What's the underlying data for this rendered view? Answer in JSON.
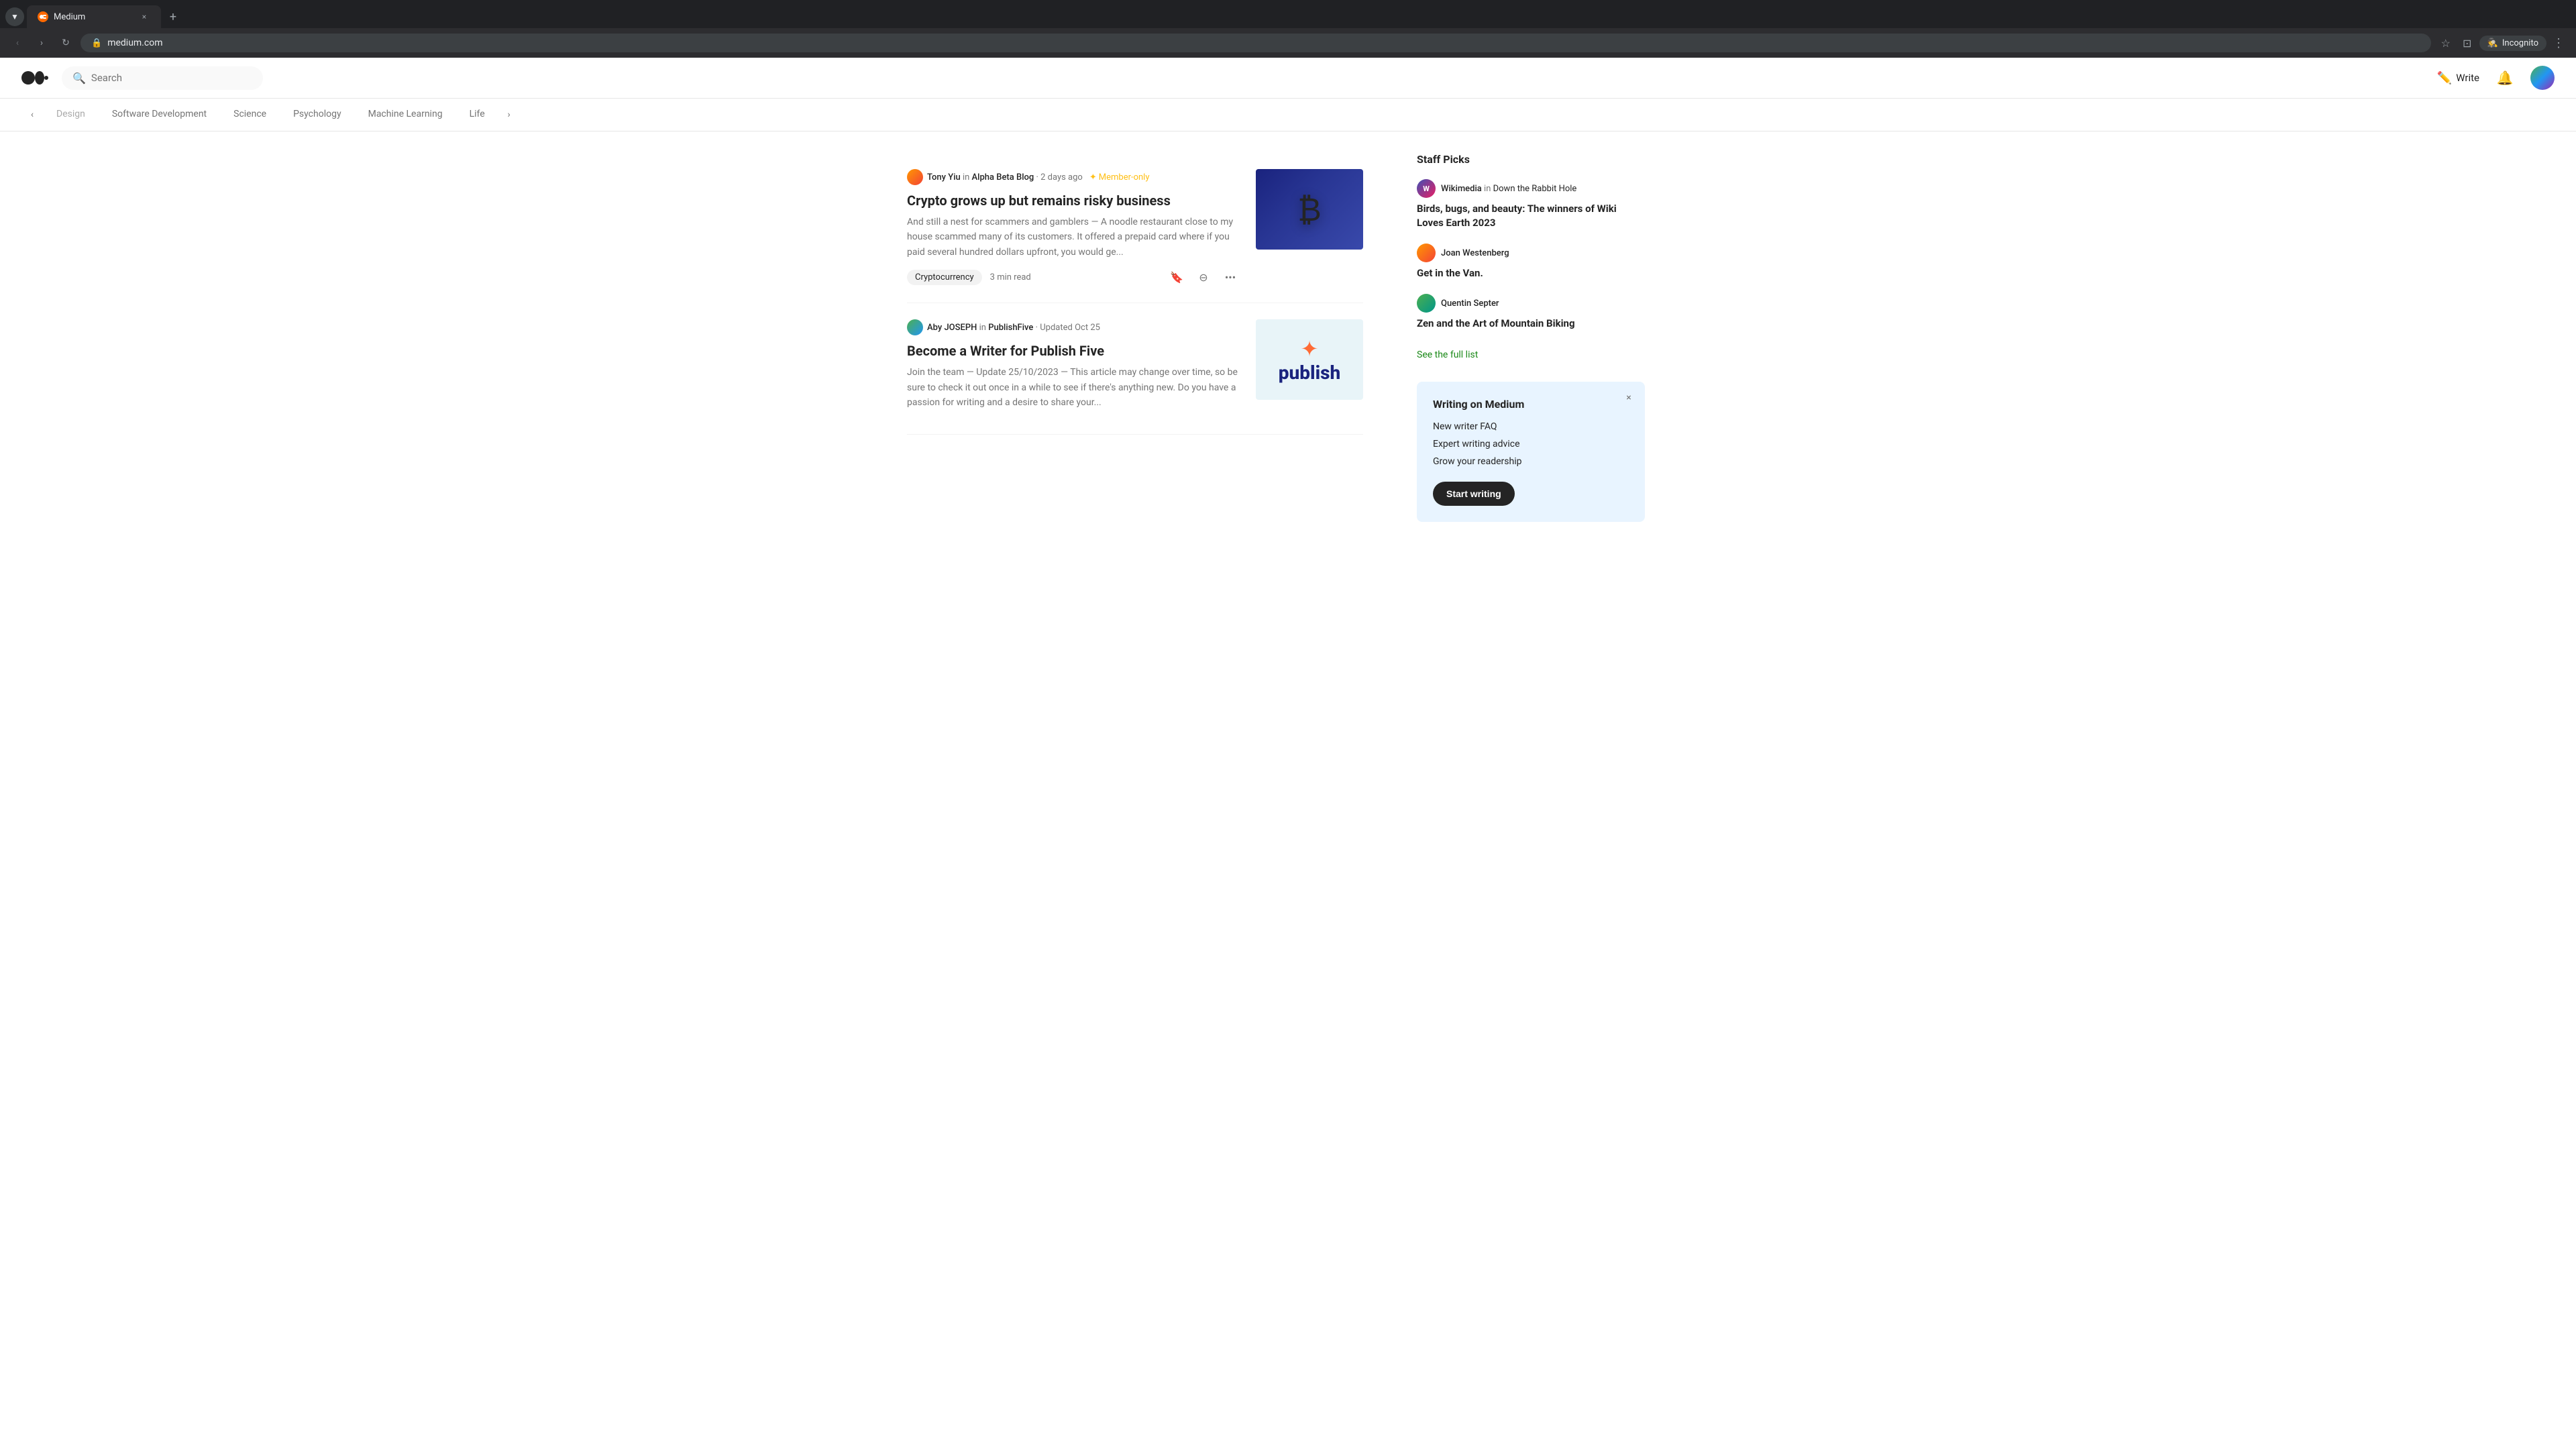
{
  "browser": {
    "tab": {
      "favicon": "M",
      "title": "Medium",
      "close_label": "×"
    },
    "new_tab_label": "+",
    "nav": {
      "back_label": "‹",
      "forward_label": "›",
      "reload_label": "↻",
      "url": "medium.com"
    },
    "toolbar": {
      "star_label": "☆",
      "split_label": "⊡",
      "incognito_label": "Incognito",
      "menu_label": "⋮"
    }
  },
  "header": {
    "logo_alt": "Medium",
    "search_placeholder": "Search",
    "write_label": "Write",
    "notifications_label": "🔔",
    "avatar_alt": "User avatar"
  },
  "categories": {
    "prev_label": "‹",
    "next_label": "›",
    "items": [
      {
        "label": "Design",
        "active": false,
        "faded": true
      },
      {
        "label": "Software Development",
        "active": false
      },
      {
        "label": "Science",
        "active": false
      },
      {
        "label": "Psychology",
        "active": false
      },
      {
        "label": "Machine Learning",
        "active": false
      },
      {
        "label": "Life",
        "active": false
      }
    ]
  },
  "articles": [
    {
      "author_name": "Tony Yiu",
      "author_in": "in",
      "publication": "Alpha Beta Blog",
      "time_ago": "2 days ago",
      "member_only": true,
      "member_label": "Member-only",
      "title": "Crypto grows up but remains risky business",
      "excerpt": "And still a nest for scammers and gamblers — A noodle restaurant close to my house scammed many of its customers. It offered a prepaid card where if you paid several hundred dollars upfront, you would ge...",
      "tag": "Cryptocurrency",
      "read_time": "3 min read",
      "actions": {
        "bookmark_label": "+",
        "less_label": "–",
        "more_label": "•••"
      },
      "thumbnail_type": "crypto"
    },
    {
      "author_name": "Aby JOSEPH",
      "author_in": "in",
      "publication": "PublishFive",
      "time_prefix": "Updated",
      "time_ago": "Oct 25",
      "member_only": false,
      "title": "Become a Writer for Publish Five",
      "excerpt": "Join the team — Update 25/10/2023 — This article may change over time, so be sure to check it out once in a while to see if there's anything new. Do you have a passion for writing and a desire to share your...",
      "tag": "",
      "read_time": "",
      "thumbnail_type": "publish"
    }
  ],
  "sidebar": {
    "staff_picks_title": "Staff Picks",
    "picks": [
      {
        "author": "Wikimedia",
        "connector": "in",
        "publication": "Down the Rabbit Hole",
        "title": "Birds, bugs, and beauty: The winners of Wiki Loves Earth 2023",
        "avatar_type": "wikimedia"
      },
      {
        "author": "Joan Westenberg",
        "connector": "",
        "publication": "",
        "title": "Get in the Van.",
        "avatar_type": "joan"
      },
      {
        "author": "Quentin Septer",
        "connector": "",
        "publication": "",
        "title": "Zen and the Art of Mountain Biking",
        "avatar_type": "quentin"
      }
    ],
    "see_full_list_label": "See the full list",
    "writing_card": {
      "title": "Writing on Medium",
      "links": [
        "New writer FAQ",
        "Expert writing advice",
        "Grow your readership"
      ],
      "close_label": "×",
      "start_writing_label": "Start writing"
    }
  }
}
